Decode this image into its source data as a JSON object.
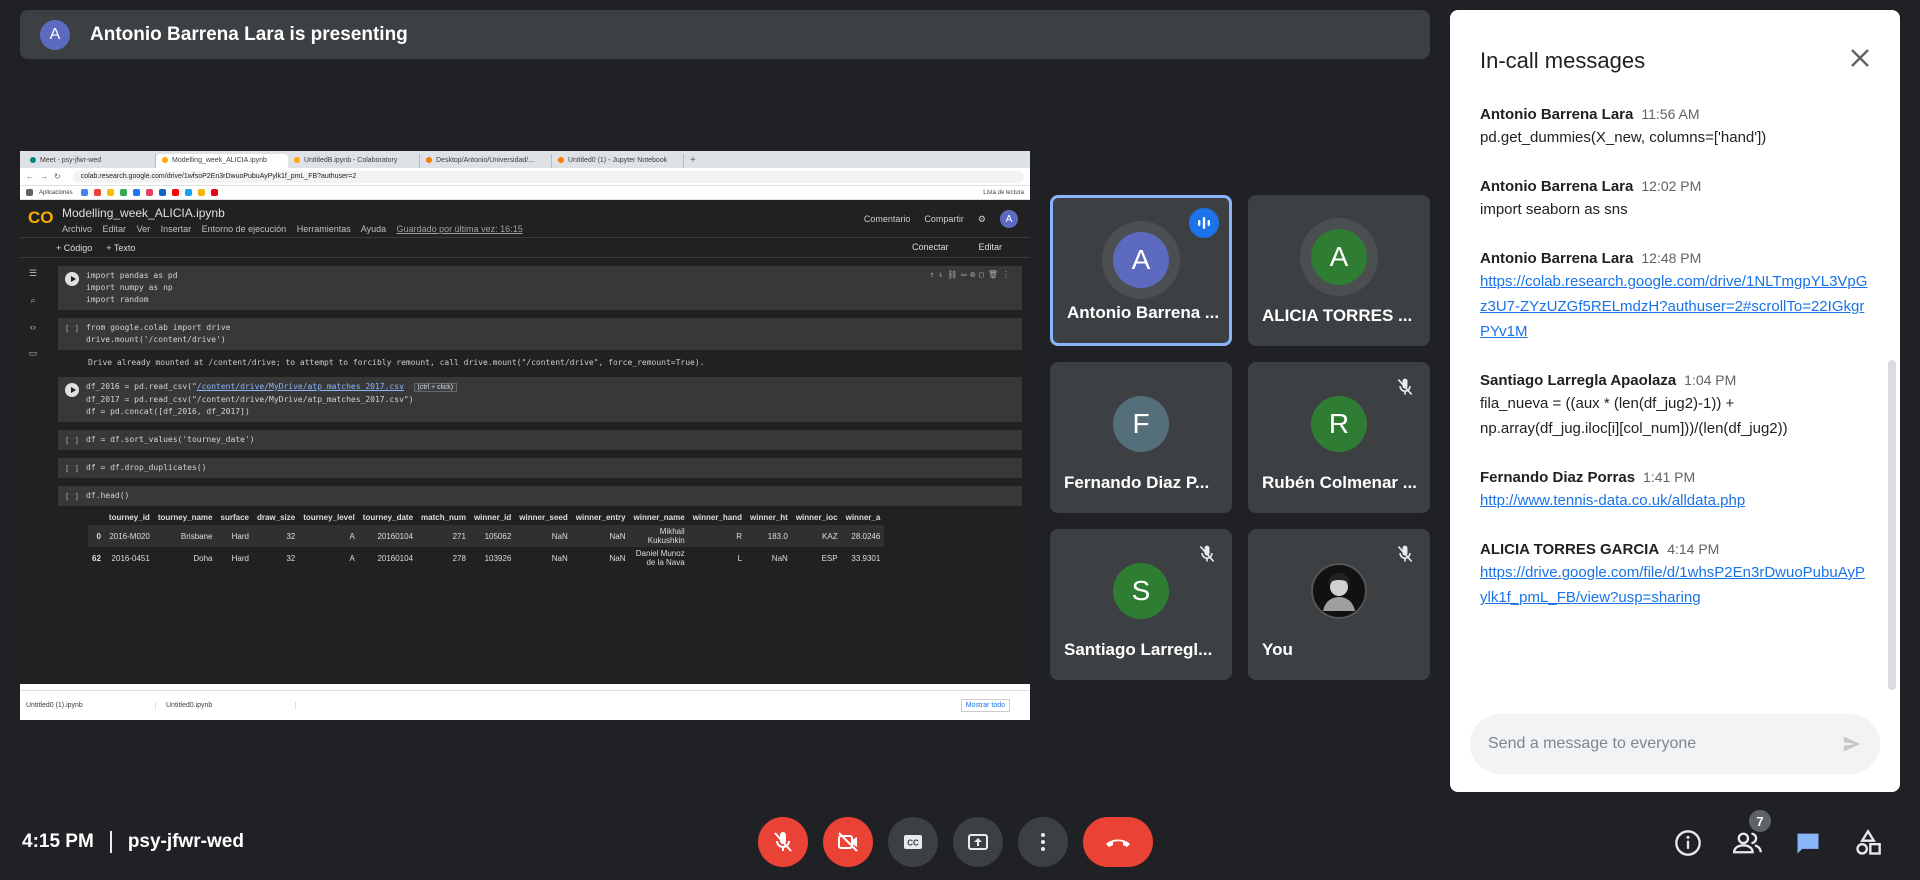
{
  "presenting": {
    "avatar": "A",
    "text": "Antonio Barrena Lara is presenting"
  },
  "screen": {
    "tabs": [
      {
        "label": "Meet - psy-jfwr-wed",
        "color": "#00897b"
      },
      {
        "label": "Modelling_week_ALICIA.ipynb",
        "color": "#f9ab00"
      },
      {
        "label": "UntitledB.ipynb - Colaboratory",
        "color": "#f9ab00"
      },
      {
        "label": "Desktop/Antonio/Universidad/...",
        "color": "#f57c00"
      },
      {
        "label": "Untitled0 (1) - Jupyter Notebook",
        "color": "#f57c00"
      }
    ],
    "url": "colab.research.google.com/drive/1wfsoP2En3rDwuoPubuAyPylk1f_pmL_FB?authuser=2",
    "bookmarks_label": "Aplicaciones",
    "bookmarks_right": "Lista de lectura",
    "notebook_title": "Modelling_week_ALICIA.ipynb",
    "menu": [
      "Archivo",
      "Editar",
      "Ver",
      "Insertar",
      "Entorno de ejecución",
      "Herramientas",
      "Ayuda"
    ],
    "saved": "Guardado por última vez: 16:15",
    "comment": "Comentario",
    "share": "Compartir",
    "user_avatar": "A",
    "toolbar": {
      "code": "+ Código",
      "text": "+ Texto",
      "connect": "Conectar",
      "edit": "Editar"
    },
    "cell1": "import pandas as pd\nimport numpy as np\nimport random",
    "cell2": "from google.colab import drive\ndrive.mount('/content/drive')",
    "cell2_out": "Drive already mounted at /content/drive; to attempt to forcibly remount, call drive.mount(\"/content/drive\", force_remount=True).",
    "cell3_a": "df_2016 = pd.read_csv(\"",
    "cell3_a_path": "/content/drive/MyDrive/atp_matches_2017.csv",
    "cell3_tip": "(ctrl + click)",
    "cell3_b": "df_2017 = pd.read_csv(\"/content/drive/MyDrive/atp_matches_2017.csv\")\ndf = pd.concat([df_2016, df_2017])",
    "cell4": "df = df.sort_values('tourney_date')",
    "cell5": "df = df.drop_duplicates()",
    "cell6": "df.head()",
    "empty_gutter": "[ ]",
    "table": {
      "headers": [
        "",
        "tourney_id",
        "tourney_name",
        "surface",
        "draw_size",
        "tourney_level",
        "tourney_date",
        "match_num",
        "winner_id",
        "winner_seed",
        "winner_entry",
        "winner_name",
        "winner_hand",
        "winner_ht",
        "winner_ioc",
        "winner_a"
      ],
      "rows": [
        [
          "0",
          "2016-M020",
          "Brisbane",
          "Hard",
          "32",
          "A",
          "20160104",
          "271",
          "105062",
          "NaN",
          "NaN",
          "Mikhail Kukushkin",
          "R",
          "183.0",
          "KAZ",
          "28.0246"
        ],
        [
          "62",
          "2016-0451",
          "Doha",
          "Hard",
          "32",
          "A",
          "20160104",
          "278",
          "103926",
          "NaN",
          "NaN",
          "Daniel Munoz de la Nava",
          "L",
          "NaN",
          "ESP",
          "33.9301"
        ]
      ]
    },
    "downloads": [
      "Untitled0 (1).ipynb",
      "Untitled0.ipynb"
    ],
    "show_all": "Mostrar todo"
  },
  "participants": [
    {
      "initial": "A",
      "name": "Antonio Barrena ...",
      "color": "#5c6bc0",
      "speaking": true,
      "muted": false
    },
    {
      "initial": "A",
      "name": "ALICIA TORRES ...",
      "color": "#2e7d32",
      "speaking": false,
      "muted": false
    },
    {
      "initial": "F",
      "name": "Fernando Diaz P...",
      "color": "#546e7a",
      "speaking": false,
      "muted": false
    },
    {
      "initial": "R",
      "name": "Rubén Colmenar ...",
      "color": "#2e7d32",
      "speaking": false,
      "muted": true
    },
    {
      "initial": "S",
      "name": "Santiago Larregl...",
      "color": "#2e7d32",
      "speaking": false,
      "muted": true
    },
    {
      "initial": "",
      "name": "You",
      "color": "#111111",
      "speaking": false,
      "muted": true
    }
  ],
  "chat": {
    "title": "In-call messages",
    "messages": [
      {
        "sender": "Antonio Barrena Lara",
        "time": "11:56 AM",
        "text": "pd.get_dummies(X_new, columns=['hand'])",
        "link": false
      },
      {
        "sender": "Antonio Barrena Lara",
        "time": "12:02 PM",
        "text": "import seaborn as sns",
        "link": false
      },
      {
        "sender": "Antonio Barrena Lara",
        "time": "12:48 PM",
        "text": "https://colab.research.google.com/drive/1NLTmgpYL3VpGz3U7-ZYzUZGf5RELmdzH?authuser=2#scrollTo=22IGkgrPYv1M",
        "link": true
      },
      {
        "sender": "Santiago Larregla Apaolaza",
        "time": "1:04 PM",
        "text": "fila_nueva = ((aux * (len(df_jug2)-1)) + np.array(df_jug.iloc[i][col_num]))/(len(df_jug2))",
        "link": false
      },
      {
        "sender": "Fernando Diaz Porras",
        "time": "1:41 PM",
        "text": "http://www.tennis-data.co.uk/alldata.php",
        "link": true
      },
      {
        "sender": "ALICIA TORRES GARCIA",
        "time": "4:14 PM",
        "text": "https://drive.google.com/file/d/1whsP2En3rDwuoPubuAyPylk1f_pmL_FB/view?usp=sharing",
        "link": true
      }
    ],
    "input_placeholder": "Send a message to everyone"
  },
  "bottom": {
    "time": "4:15 PM",
    "meeting_code": "psy-jfwr-wed",
    "participant_count": "7"
  },
  "colors": {
    "accent": "#1a73e8",
    "danger": "#ea4335",
    "surface": "#3c4043",
    "background": "#202124"
  }
}
